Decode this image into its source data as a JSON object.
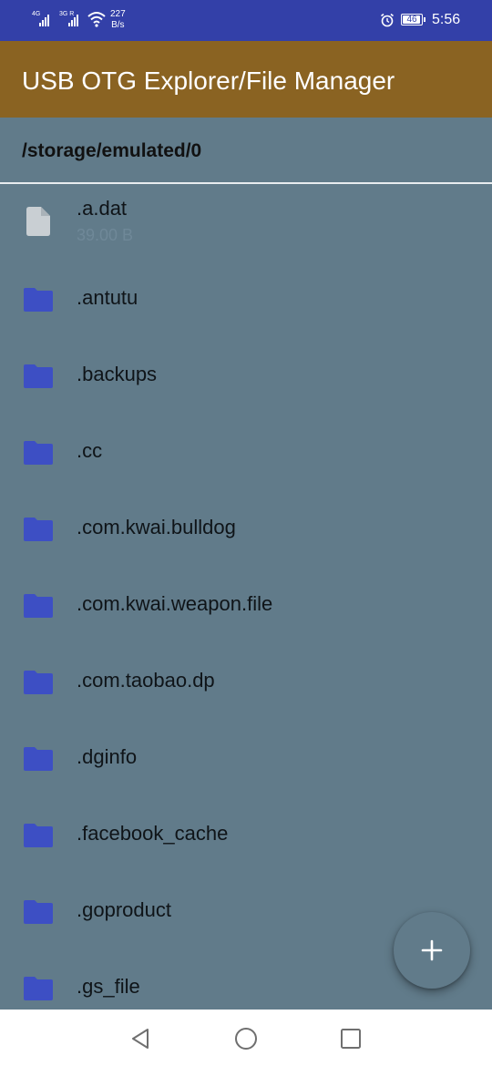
{
  "status_bar": {
    "sim1_label": "4G",
    "sim2_label": "3G R",
    "net_speed_value": "227",
    "net_speed_unit": "B/s",
    "battery_level": "46",
    "time": "5:56"
  },
  "app_bar": {
    "title": "USB OTG Explorer/File Manager"
  },
  "path": "/storage/emulated/0",
  "files": [
    {
      "name": ".a.dat",
      "size": "39.00 B",
      "type": "file"
    },
    {
      "name": ".antutu",
      "type": "folder"
    },
    {
      "name": ".backups",
      "type": "folder"
    },
    {
      "name": ".cc",
      "type": "folder"
    },
    {
      "name": ".com.kwai.bulldog",
      "type": "folder"
    },
    {
      "name": ".com.kwai.weapon.file",
      "type": "folder"
    },
    {
      "name": ".com.taobao.dp",
      "type": "folder"
    },
    {
      "name": ".dginfo",
      "type": "folder"
    },
    {
      "name": ".facebook_cache",
      "type": "folder"
    },
    {
      "name": ".goproduct",
      "type": "folder"
    },
    {
      "name": ".gs_file",
      "type": "folder"
    }
  ],
  "fab": {
    "icon": "plus-icon"
  },
  "colors": {
    "status_bar": "#3340a8",
    "app_bar": "#8a6322",
    "background": "#617b8a",
    "folder_icon": "#3d4fc4",
    "file_icon": "#c9cfd3"
  }
}
